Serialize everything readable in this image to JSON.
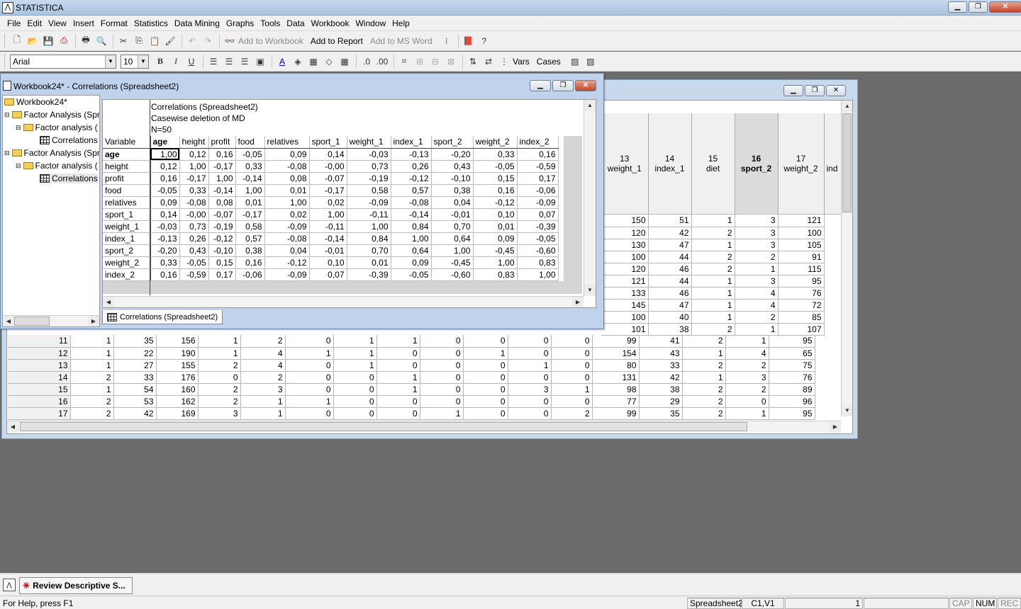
{
  "app": {
    "title": "STATISTICA"
  },
  "menu": [
    "File",
    "Edit",
    "View",
    "Insert",
    "Format",
    "Statistics",
    "Data Mining",
    "Graphs",
    "Tools",
    "Data",
    "Workbook",
    "Window",
    "Help"
  ],
  "toolbar1": {
    "add_to_workbook": "Add to Workbook",
    "add_to_report": "Add to Report",
    "add_to_msword": "Add to MS Word"
  },
  "toolbar2": {
    "font": "Arial",
    "size": "10",
    "vars": "Vars",
    "cases": "Cases"
  },
  "workbook": {
    "title": "Workbook24* - Correlations (Spreadsheet2)",
    "tree": [
      {
        "label": "Workbook24*",
        "level": 0,
        "icon": "folder"
      },
      {
        "label": "Factor Analysis (Spr",
        "level": 1,
        "icon": "folder"
      },
      {
        "label": "Factor analysis (",
        "level": 2,
        "icon": "folder"
      },
      {
        "label": "Correlations",
        "level": 3,
        "icon": "sheet"
      },
      {
        "label": "Factor Analysis (Spr",
        "level": 1,
        "icon": "folder"
      },
      {
        "label": "Factor analysis (",
        "level": 2,
        "icon": "folder"
      },
      {
        "label": "Correlations",
        "level": 3,
        "icon": "sheet"
      }
    ],
    "tab": "Correlations (Spreadsheet2)"
  },
  "correlations": {
    "header": [
      "Correlations (Spreadsheet2)",
      "Casewise deletion of MD",
      "N=50"
    ],
    "corner": "Variable",
    "columns": [
      "age",
      "height",
      "profit",
      "food",
      "relatives",
      "sport_1",
      "weight_1",
      "index_1",
      "sport_2",
      "weight_2",
      "index_2"
    ],
    "rows": [
      {
        "label": "age",
        "values": [
          "1,00",
          "0,12",
          "0,16",
          "-0,05",
          "0,09",
          "0,14",
          "-0,03",
          "-0,13",
          "-0,20",
          "0,33",
          "0,16"
        ]
      },
      {
        "label": "height",
        "values": [
          "0,12",
          "1,00",
          "-0,17",
          "0,33",
          "-0,08",
          "-0,00",
          "0,73",
          "0,26",
          "0,43",
          "-0,05",
          "-0,59"
        ]
      },
      {
        "label": "profit",
        "values": [
          "0,16",
          "-0,17",
          "1,00",
          "-0,14",
          "0,08",
          "-0,07",
          "-0,19",
          "-0,12",
          "-0,10",
          "0,15",
          "0,17"
        ]
      },
      {
        "label": "food",
        "values": [
          "-0,05",
          "0,33",
          "-0,14",
          "1,00",
          "0,01",
          "-0,17",
          "0,58",
          "0,57",
          "0,38",
          "0,16",
          "-0,06"
        ]
      },
      {
        "label": "relatives",
        "values": [
          "0,09",
          "-0,08",
          "0,08",
          "0,01",
          "1,00",
          "0,02",
          "-0,09",
          "-0,08",
          "0,04",
          "-0,12",
          "-0,09"
        ]
      },
      {
        "label": "sport_1",
        "values": [
          "0,14",
          "-0,00",
          "-0,07",
          "-0,17",
          "0,02",
          "1,00",
          "-0,11",
          "-0,14",
          "-0,01",
          "0,10",
          "0,07"
        ]
      },
      {
        "label": "weight_1",
        "values": [
          "-0,03",
          "0,73",
          "-0,19",
          "0,58",
          "-0,09",
          "-0,11",
          "1,00",
          "0,84",
          "0,70",
          "0,01",
          "-0,39"
        ]
      },
      {
        "label": "index_1",
        "values": [
          "-0,13",
          "0,26",
          "-0,12",
          "0,57",
          "-0,08",
          "-0,14",
          "0,84",
          "1,00",
          "0,64",
          "0,09",
          "-0,05"
        ]
      },
      {
        "label": "sport_2",
        "values": [
          "-0,20",
          "0,43",
          "-0,10",
          "0,38",
          "0,04",
          "-0,01",
          "0,70",
          "0,64",
          "1,00",
          "-0,45",
          "-0,60"
        ]
      },
      {
        "label": "weight_2",
        "values": [
          "0,33",
          "-0,05",
          "0,15",
          "0,16",
          "-0,12",
          "0,10",
          "0,01",
          "0,09",
          "-0,45",
          "1,00",
          "0,83"
        ]
      },
      {
        "label": "index_2",
        "values": [
          "0,16",
          "-0,59",
          "0,17",
          "-0,06",
          "-0,09",
          "0,07",
          "-0,39",
          "-0,05",
          "-0,60",
          "0,83",
          "1,00"
        ]
      }
    ]
  },
  "data_sheet": {
    "columns": [
      {
        "num": "13",
        "name": "weight_1"
      },
      {
        "num": "14",
        "name": "index_1"
      },
      {
        "num": "15",
        "name": "diet"
      },
      {
        "num": "16",
        "name": "sport_2"
      },
      {
        "num": "17",
        "name": "weight_2"
      },
      {
        "num": "",
        "name": "ind"
      }
    ],
    "top_rows": [
      [
        "150",
        "51",
        "1",
        "3",
        "121"
      ],
      [
        "120",
        "42",
        "2",
        "3",
        "100"
      ],
      [
        "130",
        "47",
        "1",
        "3",
        "105"
      ],
      [
        "100",
        "44",
        "2",
        "2",
        "91"
      ],
      [
        "120",
        "46",
        "2",
        "1",
        "115"
      ],
      [
        "121",
        "44",
        "1",
        "3",
        "95"
      ],
      [
        "133",
        "46",
        "1",
        "4",
        "76"
      ],
      [
        "145",
        "47",
        "1",
        "4",
        "72"
      ],
      [
        "100",
        "40",
        "1",
        "2",
        "85"
      ],
      [
        "101",
        "38",
        "2",
        "1",
        "107"
      ]
    ],
    "rows": [
      [
        "11",
        "1",
        "35",
        "156",
        "1",
        "2",
        "0",
        "1",
        "1",
        "0",
        "0",
        "0",
        "0",
        "99",
        "41",
        "2",
        "1",
        "95"
      ],
      [
        "12",
        "1",
        "22",
        "190",
        "1",
        "4",
        "1",
        "1",
        "0",
        "0",
        "1",
        "0",
        "0",
        "154",
        "43",
        "1",
        "4",
        "65"
      ],
      [
        "13",
        "1",
        "27",
        "155",
        "2",
        "4",
        "0",
        "1",
        "0",
        "0",
        "0",
        "1",
        "0",
        "80",
        "33",
        "2",
        "2",
        "75"
      ],
      [
        "14",
        "2",
        "33",
        "176",
        "0",
        "2",
        "0",
        "0",
        "1",
        "0",
        "0",
        "0",
        "0",
        "131",
        "42",
        "1",
        "3",
        "76"
      ],
      [
        "15",
        "1",
        "54",
        "160",
        "2",
        "3",
        "0",
        "0",
        "1",
        "0",
        "0",
        "3",
        "1",
        "98",
        "38",
        "2",
        "2",
        "89"
      ],
      [
        "16",
        "2",
        "53",
        "162",
        "2",
        "1",
        "1",
        "0",
        "0",
        "0",
        "0",
        "0",
        "0",
        "77",
        "29",
        "2",
        "0",
        "96"
      ],
      [
        "17",
        "2",
        "42",
        "169",
        "3",
        "1",
        "0",
        "0",
        "0",
        "1",
        "0",
        "0",
        "2",
        "99",
        "35",
        "2",
        "1",
        "95"
      ]
    ]
  },
  "taskbar": {
    "item": "Review Descriptive S..."
  },
  "status": {
    "help": "For Help, press F1",
    "sheet": "Spreadsheet2",
    "cell": "C1,V1",
    "num": "1",
    "cap": "CAP",
    "numlock": "NUM",
    "rec": "REC"
  }
}
